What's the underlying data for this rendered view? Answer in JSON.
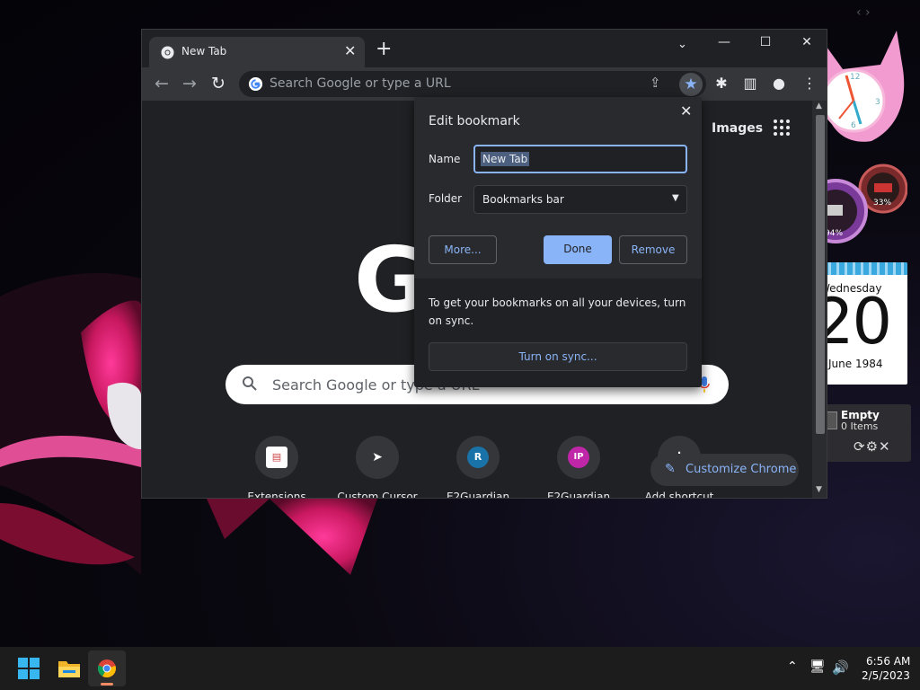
{
  "gadgets": {
    "calendar": {
      "weekday": "Wednesday",
      "day": "20",
      "month_year": "June 1984"
    },
    "recycle_bin": {
      "title": "Empty",
      "items": "0 Items"
    },
    "meter": {
      "cpu": "33%",
      "ram": "94%"
    },
    "nav": "‹  ›"
  },
  "browser": {
    "tab": {
      "title": "New Tab",
      "close": "✕"
    },
    "new_tab": "+",
    "tab_search": "⌄",
    "window_controls": {
      "minimize": "—",
      "maximize": "☐",
      "close": "✕"
    },
    "nav": {
      "back": "←",
      "forward": "→",
      "reload": "↻"
    },
    "omnibox": {
      "placeholder": "Search Google or type a URL",
      "share": "⇪",
      "star": "★"
    },
    "toolbar_icons": {
      "extensions": "✱",
      "side_panel": "▥",
      "profile": "●",
      "menu": "⋮"
    }
  },
  "ntp": {
    "images_link": "Images",
    "logo": "G",
    "search": {
      "placeholder": "Search Google or type a URL"
    },
    "shortcuts": [
      {
        "label": "Extensions",
        "glyph": "▤",
        "color": "#ffffff"
      },
      {
        "label": "Custom Cursor",
        "glyph": "➤",
        "color": "#202124"
      },
      {
        "label": "E2Guardian",
        "glyph": "R",
        "color": "#1a73a8"
      },
      {
        "label": "E2Guardian",
        "glyph": "IP",
        "color": "#c026a8"
      },
      {
        "label": "Add shortcut",
        "glyph": "+",
        "color": "#35363a"
      }
    ],
    "customize": {
      "icon": "✎",
      "label": "Customize Chrome"
    }
  },
  "bookmark_dialog": {
    "title": "Edit bookmark",
    "close": "✕",
    "name_label": "Name",
    "name_value": "New Tab",
    "folder_label": "Folder",
    "folder_value": "Bookmarks bar",
    "folder_caret": "▼",
    "more_label": "More...",
    "done_label": "Done",
    "remove_label": "Remove",
    "sync_text": "To get your bookmarks on all your devices, turn on sync.",
    "sync_button": "Turn on sync..."
  },
  "taskbar": {
    "tray": {
      "chevron": "⌃",
      "network": "🖥",
      "volume": "🔊"
    },
    "time": "6:56 AM",
    "date": "2/5/2023"
  },
  "colors": {
    "accent": "#8ab4f8",
    "chrome_dark": "#202124",
    "toolbar": "#35363a"
  },
  "scroll": {
    "up": "▲",
    "down": "▼"
  }
}
